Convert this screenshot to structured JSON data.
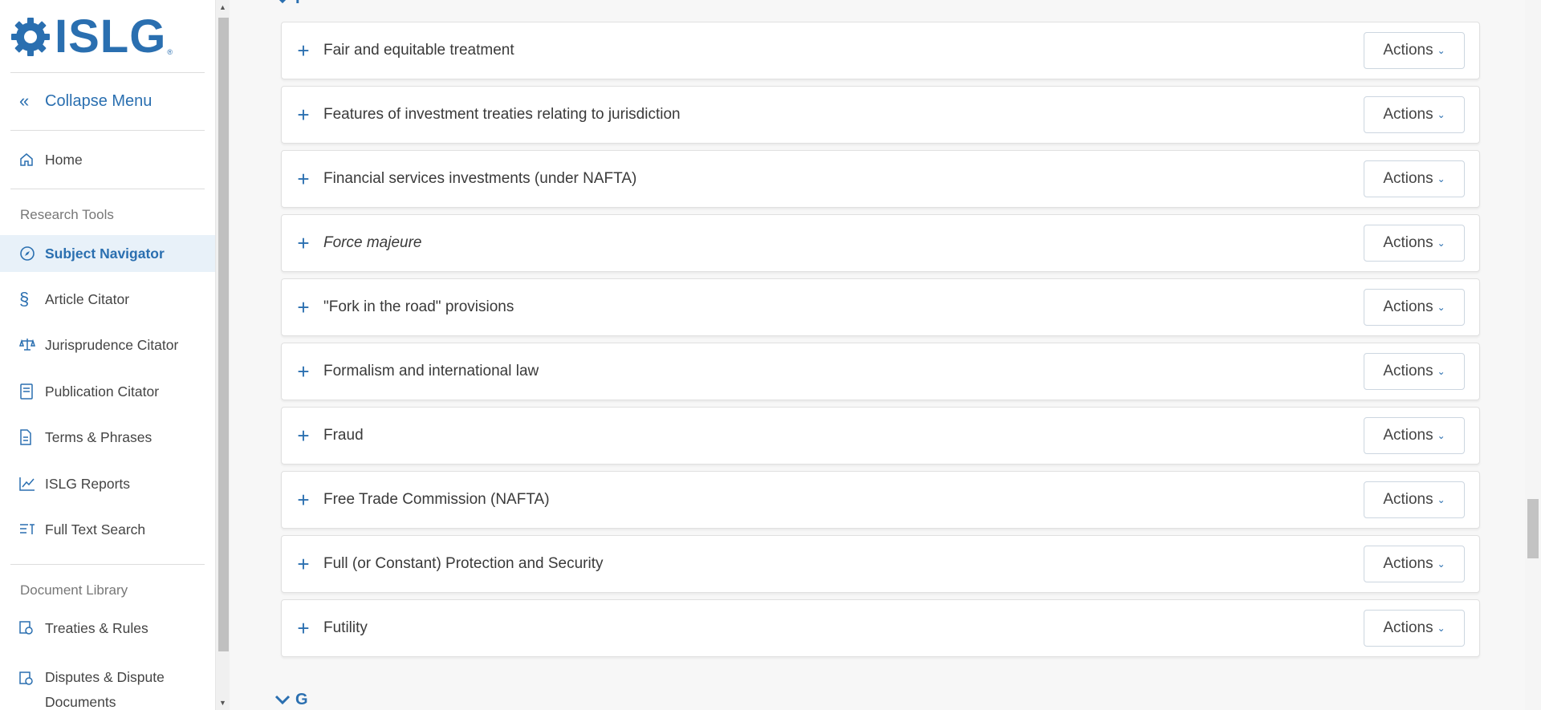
{
  "brand": {
    "name": "ISLG",
    "reg": "®"
  },
  "sidebar": {
    "collapse_label": "Collapse Menu",
    "home_label": "Home",
    "research_tools_label": "Research Tools",
    "research_items": [
      {
        "label": "Subject Navigator"
      },
      {
        "label": "Article Citator"
      },
      {
        "label": "Jurisprudence Citator"
      },
      {
        "label": "Publication Citator"
      },
      {
        "label": "Terms & Phrases"
      },
      {
        "label": "ISLG Reports"
      },
      {
        "label": "Full Text Search"
      }
    ],
    "document_library_label": "Document Library",
    "library_items": [
      {
        "label": "Treaties & Rules"
      },
      {
        "label": "Disputes & Dispute Documents"
      }
    ]
  },
  "main": {
    "prev_letter": "F",
    "next_letter": "G",
    "actions_label": "Actions",
    "rows": [
      {
        "title": "Fair and equitable treatment"
      },
      {
        "title": "Features of investment treaties relating to jurisdiction"
      },
      {
        "title": "Financial services investments (under NAFTA)"
      },
      {
        "title": "Force majeure"
      },
      {
        "title": "\"Fork in the road\" provisions"
      },
      {
        "title": "Formalism and international law"
      },
      {
        "title": "Fraud"
      },
      {
        "title": "Free Trade Commission (NAFTA)"
      },
      {
        "title": "Full (or Constant) Protection and Security"
      },
      {
        "title": "Futility"
      }
    ]
  },
  "colors": {
    "accent": "#2a6fb0",
    "active_bg": "#e8f1f9"
  }
}
